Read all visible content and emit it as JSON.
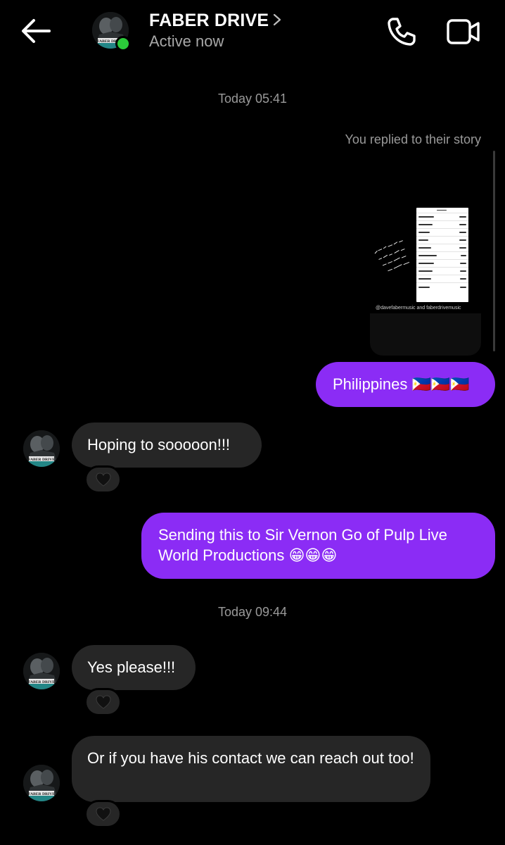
{
  "header": {
    "title": "FABER DRIVE",
    "status": "Active now",
    "avatar_text": "FABER DRIVE"
  },
  "icons": {
    "back": "arrow-left-icon",
    "call": "phone-icon",
    "video": "video-camera-icon",
    "chevron": "chevron-right-icon",
    "reaction": "black-heart-icon"
  },
  "messages": {
    "timestamp_1": "Today 05:41",
    "story_reply_label": "You replied to their story",
    "story_caption": "@davefabermusic and faberdrivemusic",
    "story_handwriting": "THAT'S OUR TOP CITIES SO CHECK IT! WHO WANTS TO SEE US IN THE PHILIPPINES?",
    "msg_1": "Philippines 🇵🇭🇵🇭🇵🇭",
    "msg_2": "Hoping to sooooon!!!",
    "msg_3": "Sending this to Sir Vernon Go of Pulp Live World Productions 😁😁😁",
    "timestamp_2": "Today 09:44",
    "msg_4": "Yes please!!!",
    "msg_5": "Or if you have his contact we can reach out too!",
    "reaction": "🖤"
  },
  "colors": {
    "background": "#000000",
    "outgoing_bubble": "#8b2cf5",
    "incoming_bubble": "#262626",
    "online": "#2bcc3a",
    "muted_text": "#9a9a9a"
  }
}
